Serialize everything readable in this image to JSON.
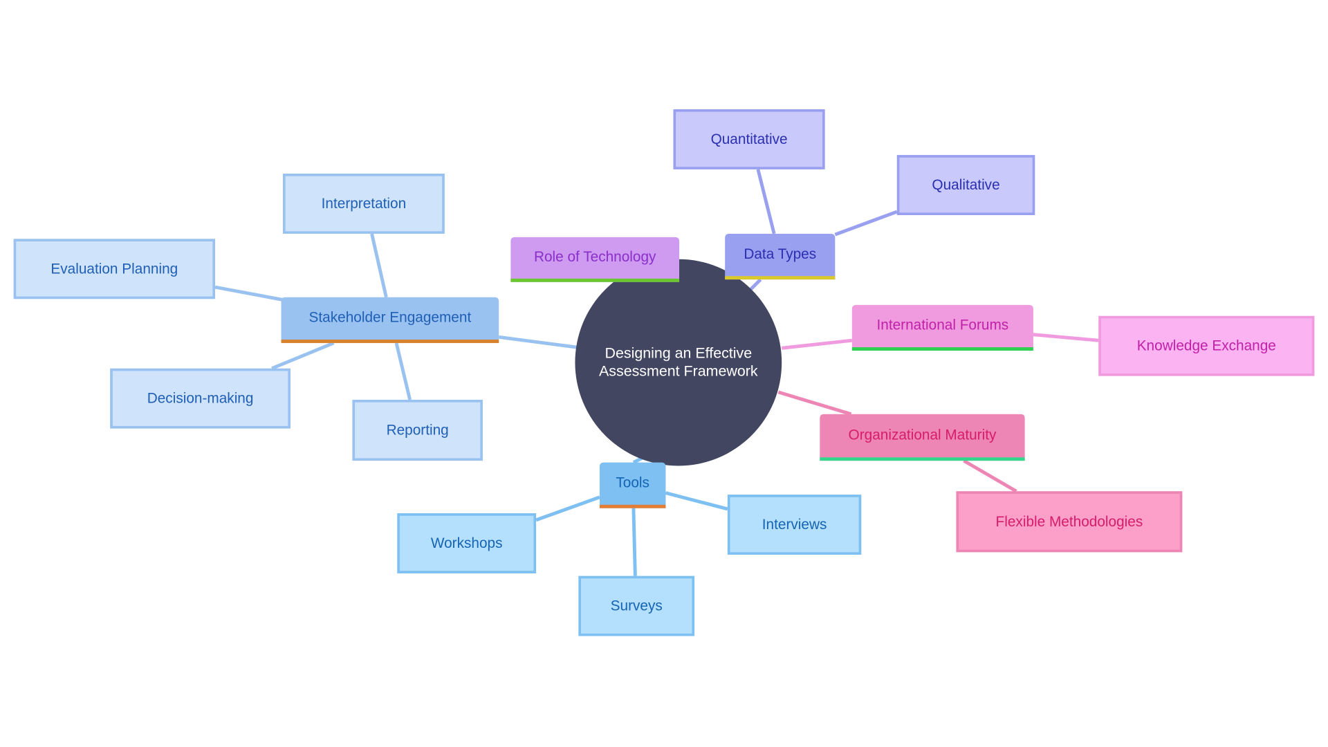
{
  "diagram": {
    "type": "mindmap",
    "root": {
      "label_lines": [
        "Designing an Effective",
        "Assessment Framework"
      ],
      "fill": "#424660",
      "text_color": "#ffffff"
    },
    "branches": [
      {
        "id": "stakeholder",
        "label": "Stakeholder Engagement",
        "fill": "#9ac2f0",
        "text_color": "#1f5fb5",
        "underline": "#d9822b",
        "edge_color": "#9ac2f0",
        "children": [
          {
            "label": "Interpretation",
            "fill": "#cfe3fb",
            "stroke": "#9ac2f0",
            "text_color": "#1f5fb5"
          },
          {
            "label": "Evaluation Planning",
            "fill": "#cfe3fb",
            "stroke": "#9ac2f0",
            "text_color": "#1f5fb5"
          },
          {
            "label": "Decision-making",
            "fill": "#cfe3fb",
            "stroke": "#9ac2f0",
            "text_color": "#1f5fb5"
          },
          {
            "label": "Reporting",
            "fill": "#cfe3fb",
            "stroke": "#9ac2f0",
            "text_color": "#1f5fb5"
          }
        ]
      },
      {
        "id": "technology",
        "label": "Role of Technology",
        "fill": "#cf9bf0",
        "text_color": "#8a2fc9",
        "underline": "#6ac730",
        "edge_color": "#cf9bf0",
        "children": []
      },
      {
        "id": "datatypes",
        "label": "Data Types",
        "fill": "#9aa0f0",
        "text_color": "#2a2fb0",
        "underline": "#d9c92b",
        "edge_color": "#9aa0f0",
        "children": [
          {
            "label": "Quantitative",
            "fill": "#c9cafb",
            "stroke": "#9aa0f0",
            "text_color": "#2a2fb0"
          },
          {
            "label": "Qualitative",
            "fill": "#c9cafb",
            "stroke": "#9aa0f0",
            "text_color": "#2a2fb0"
          }
        ]
      },
      {
        "id": "forums",
        "label": "International Forums",
        "fill": "#f09be0",
        "text_color": "#c021a8",
        "underline": "#2fcf50",
        "edge_color": "#f09be0",
        "children": [
          {
            "label": "Knowledge Exchange",
            "fill": "#fbb3f2",
            "stroke": "#f09be0",
            "text_color": "#c021a8"
          }
        ]
      },
      {
        "id": "maturity",
        "label": "Organizational Maturity",
        "fill": "#ed86b4",
        "text_color": "#d61c6b",
        "underline": "#34d68c",
        "edge_color": "#ed86b4",
        "children": [
          {
            "label": "Flexible Methodologies",
            "fill": "#fca0ca",
            "stroke": "#ed86b4",
            "text_color": "#d61c6b"
          }
        ]
      },
      {
        "id": "tools",
        "label": "Tools",
        "fill": "#7ec0f2",
        "text_color": "#1464b4",
        "underline": "#e57e34",
        "edge_color": "#7ec0f2",
        "children": [
          {
            "label": "Workshops",
            "fill": "#b5e0fd",
            "stroke": "#7ec0f2",
            "text_color": "#1464b4"
          },
          {
            "label": "Surveys",
            "fill": "#b5e0fd",
            "stroke": "#7ec0f2",
            "text_color": "#1464b4"
          },
          {
            "label": "Interviews",
            "fill": "#b5e0fd",
            "stroke": "#7ec0f2",
            "text_color": "#1464b4"
          }
        ]
      }
    ]
  }
}
